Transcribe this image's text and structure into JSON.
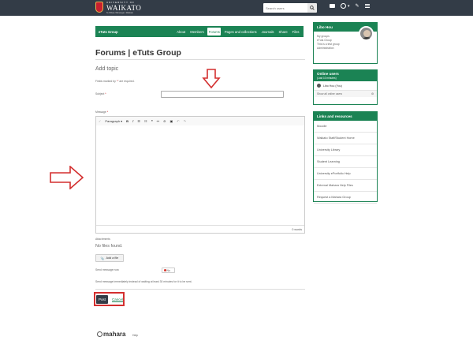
{
  "header": {
    "logo_university": "UNIVERSITY OF",
    "logo_name": "WAIKATO",
    "logo_tagline": "Te Whare Wānanga o Waikato",
    "search_placeholder": "Search users"
  },
  "group_nav": {
    "group_name": "eTuts Group",
    "tabs": [
      {
        "label": "About"
      },
      {
        "label": "Members"
      },
      {
        "label": "Forums",
        "active": true
      },
      {
        "label": "Pages and collections"
      },
      {
        "label": "Journals"
      },
      {
        "label": "Share"
      },
      {
        "label": "Files"
      }
    ]
  },
  "main": {
    "title": "Forums | eTuts Group",
    "subtitle": "Add topic",
    "required_note_prefix": "Fields marked by '",
    "required_star": "*",
    "required_note_suffix": "' are required.",
    "subject_label": "Subject",
    "message_label": "Message",
    "toolbar_paragraph": "Paragraph",
    "word_count": "0 words",
    "attachments_label": "Attachments",
    "no_files": "No files found.",
    "add_file_label": "Add a file",
    "send_now_label": "Send message now",
    "switch_label": "No",
    "send_now_help": "Send message immediately instead of waiting at least 30 minutes for it to be sent.",
    "post_label": "Post",
    "cancel_label": "Cancel"
  },
  "sidebar": {
    "profile": {
      "name": "Libo Hou",
      "links": [
        "My groups",
        "eTuts Group",
        "This is a test group",
        "Administration"
      ]
    },
    "online": {
      "title": "Online users",
      "subtitle": "(Last 10 minutes)",
      "user": "Libo Hou (You)",
      "show_all": "Show all online users"
    },
    "links": {
      "title": "Links and resources",
      "items": [
        "Moodle",
        "Waikato Staff/Student Home",
        "University Library",
        "Student Learning",
        "University ePortfolio Help",
        "External Mahara Help Files",
        "Request a Mahara Group"
      ]
    }
  },
  "footer": {
    "logo": "mahara",
    "help": "Help"
  },
  "colors": {
    "topbar": "#333c47",
    "accent": "#1b8354",
    "highlight_red": "#d32f2f"
  }
}
